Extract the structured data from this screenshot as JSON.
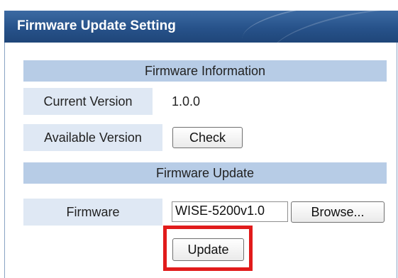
{
  "panel": {
    "title": "Firmware Update Setting"
  },
  "firmware_information": {
    "section_title": "Firmware Information",
    "current_version_label": "Current Version",
    "current_version_value": "1.0.0",
    "available_version_label": "Available Version",
    "check_button_label": "Check"
  },
  "firmware_update": {
    "section_title": "Firmware Update",
    "firmware_label": "Firmware",
    "file_value": "WISE-5200v1.0",
    "browse_button_label": "Browse...",
    "update_button_label": "Update"
  },
  "colors": {
    "header_blue": "#27528a",
    "section_blue": "#b7cce6",
    "label_bg": "#dfe8f4",
    "highlight_red": "#e11b1b"
  }
}
